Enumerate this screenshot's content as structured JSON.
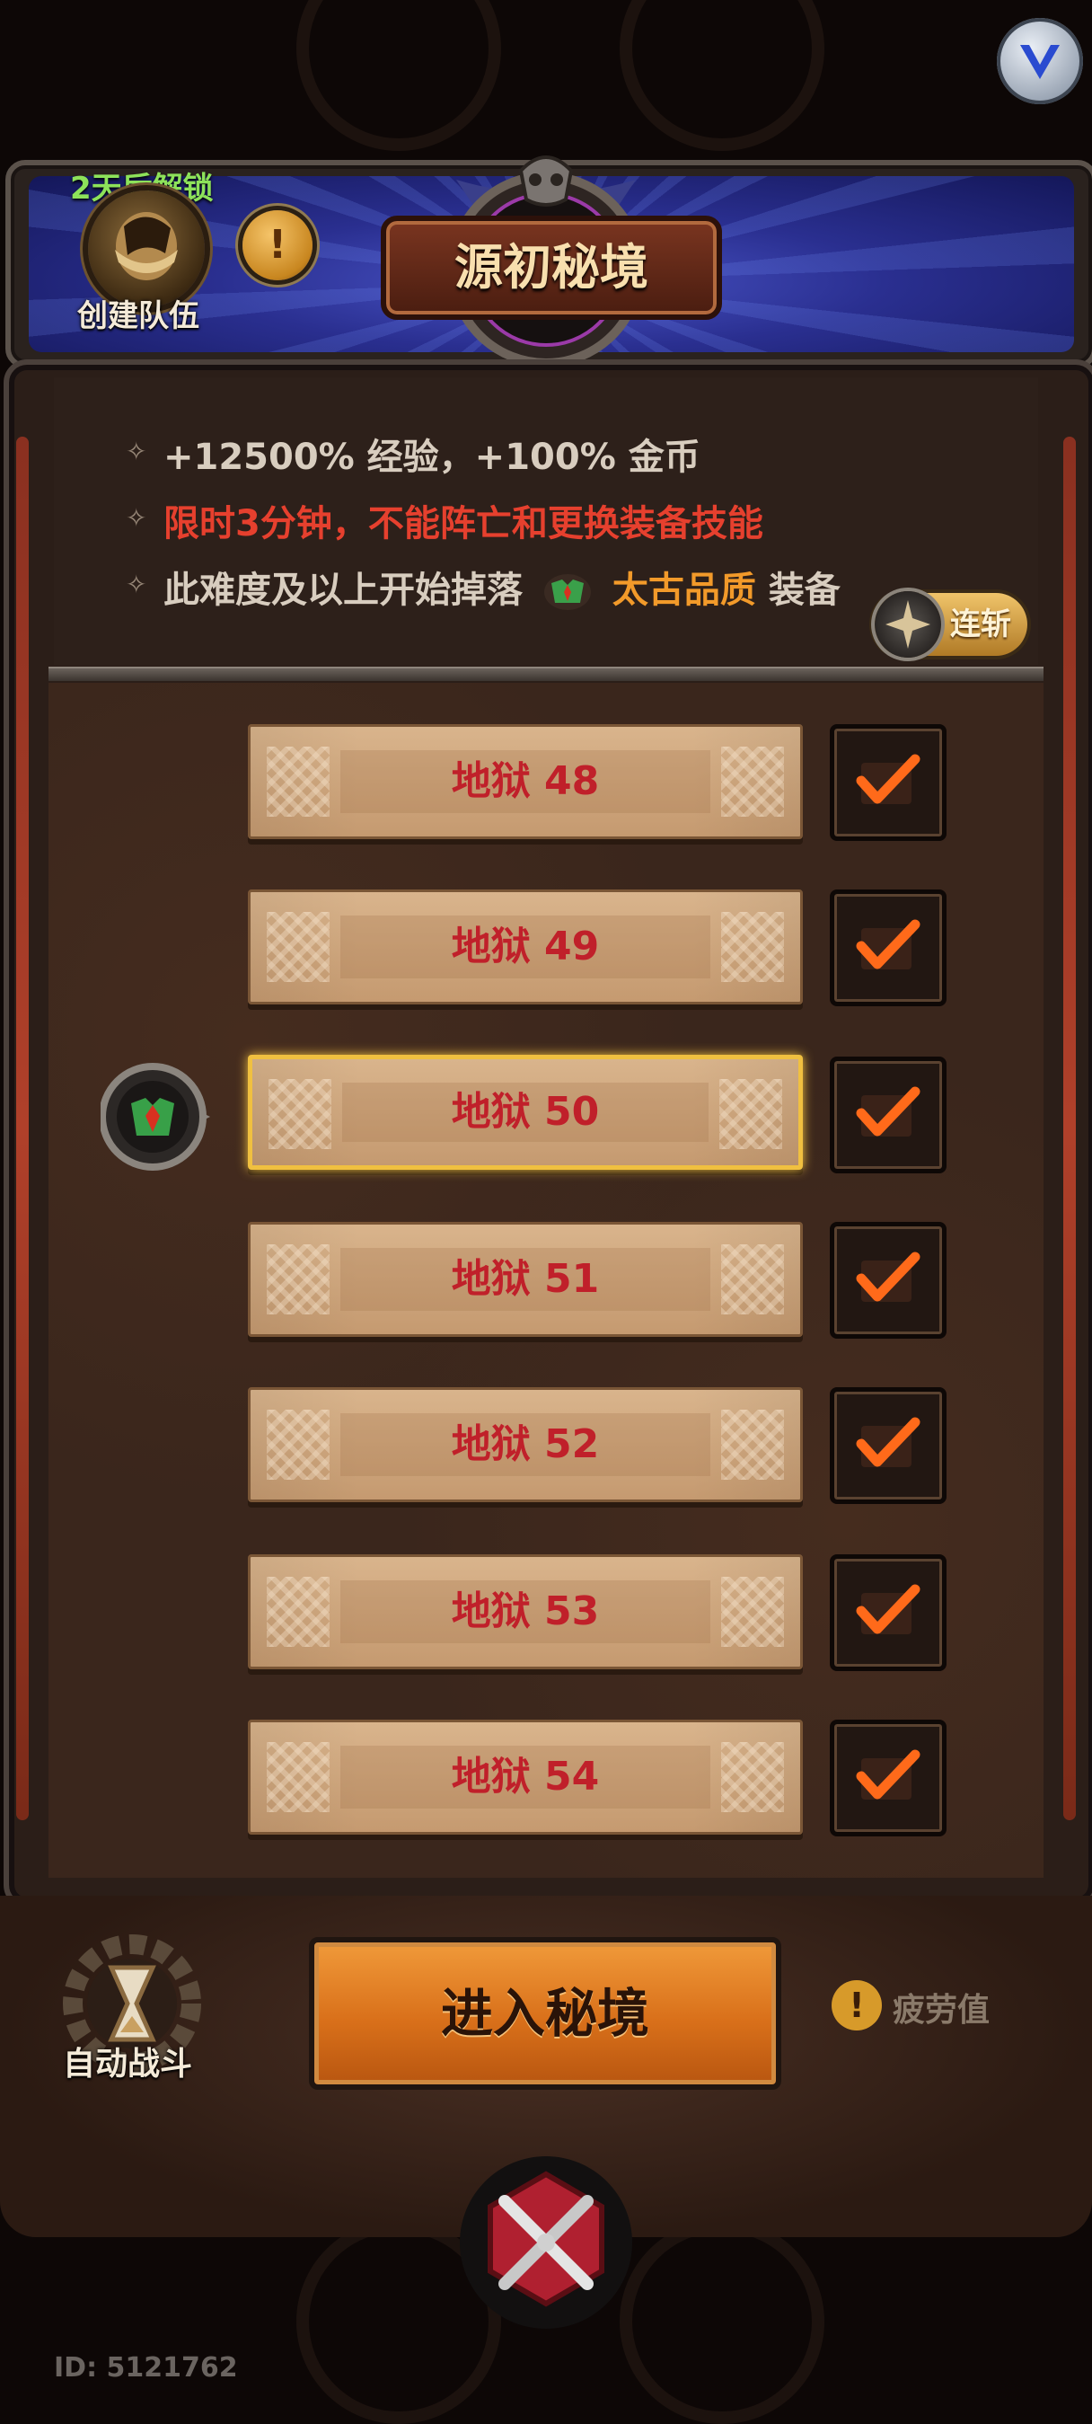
{
  "header": {
    "unlock_notice": "2天后解锁",
    "create_team_label": "创建队伍",
    "title": "源初秘境"
  },
  "info": {
    "line1": "+12500% 经验，+100% 金币",
    "line2": "限时3分钟，不能阵亡和更换装备技能",
    "line3_prefix": "此难度及以上开始掉落",
    "line3_quality": "太古品质",
    "line3_suffix": "装备",
    "combo_label": "连斩"
  },
  "levels": [
    {
      "label": "地狱 48",
      "checked": true,
      "selected": false
    },
    {
      "label": "地狱 49",
      "checked": true,
      "selected": false
    },
    {
      "label": "地狱 50",
      "checked": true,
      "selected": true
    },
    {
      "label": "地狱 51",
      "checked": true,
      "selected": false
    },
    {
      "label": "地狱 52",
      "checked": true,
      "selected": false
    },
    {
      "label": "地狱 53",
      "checked": true,
      "selected": false
    },
    {
      "label": "地狱 54",
      "checked": true,
      "selected": false
    }
  ],
  "bottom": {
    "auto_battle_label": "自动战斗",
    "enter_button": "进入秘境",
    "fatigue_label": "疲劳值",
    "user_id": "ID: 5121762"
  },
  "colors": {
    "accent_red": "#e6402e",
    "quality_orange": "#f29a2a",
    "unlock_green": "#8de25a",
    "selected_gold": "#f0c040"
  }
}
